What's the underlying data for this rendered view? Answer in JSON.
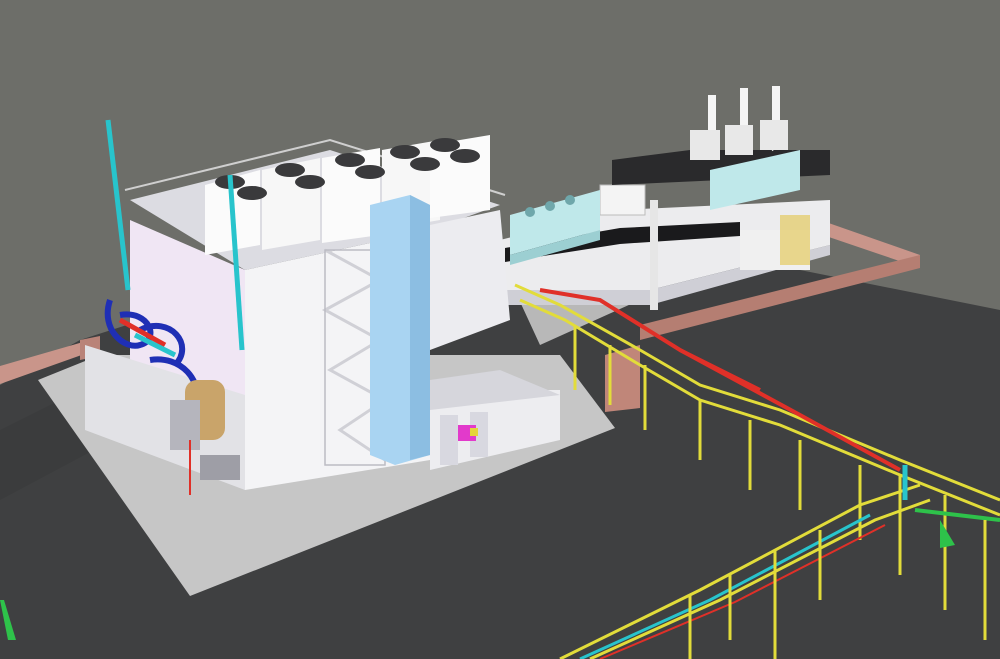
{
  "viewport": {
    "background": "#6d6e69",
    "ground_color": "#3e3f40",
    "pad_color": "#c4c4c4",
    "wall_color": "#c9958a"
  },
  "colors": {
    "building": "#f2f2f5",
    "building_shade": "#dcdce8",
    "stair_tower": "#a9d4f2",
    "pipe_rack": "#e2dc3a",
    "pipe_red": "#e03028",
    "pipe_blue": "#1f2fb5",
    "pipe_cyan": "#28c4cc",
    "pipe_green": "#2ec24a",
    "cooler_teal": "#bfe8ea"
  },
  "scene": {
    "objects": [
      "ground-slab",
      "boundary-wall",
      "main-plant-building",
      "roof-cooling-fans",
      "stair-tower",
      "boiler-piping-skid",
      "exhaust-stack",
      "auxiliary-building",
      "exhaust-stacks",
      "roof-coolers",
      "pipe-rack"
    ]
  }
}
